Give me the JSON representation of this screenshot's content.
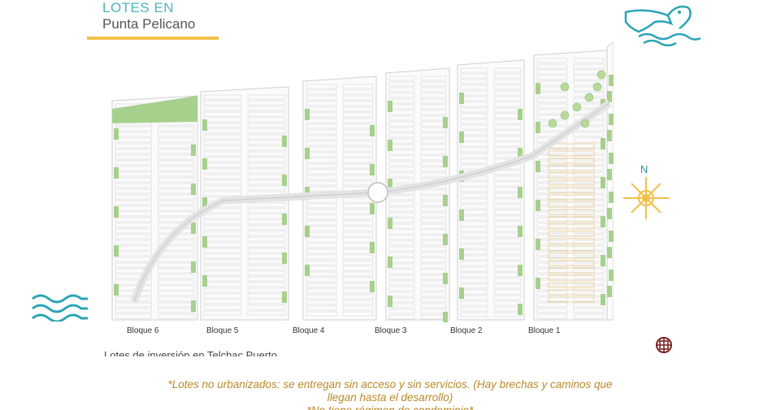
{
  "header": {
    "line1": "LOTES EN",
    "line2": "Punta Pelicano"
  },
  "compass": {
    "north_label": "N"
  },
  "bloques": [
    "Bloque 6",
    "Bloque 5",
    "Bloque 4",
    "Bloque 3",
    "Bloque 2",
    "Bloque 1"
  ],
  "caption": "Lotes de inversión en Telchac Puerto",
  "notes": {
    "line1": "*Lotes no urbanizados: se entregan sin acceso y sin servicios. (Hay brechas y caminos que",
    "line2": "llegan hasta el desarrollo)",
    "line3": "*No tiene régimen de condominio*"
  },
  "colors": {
    "teal": "#2aa5b3",
    "gold": "#f2c14a",
    "green": "#a8d08d",
    "note": "#b98a2a"
  }
}
